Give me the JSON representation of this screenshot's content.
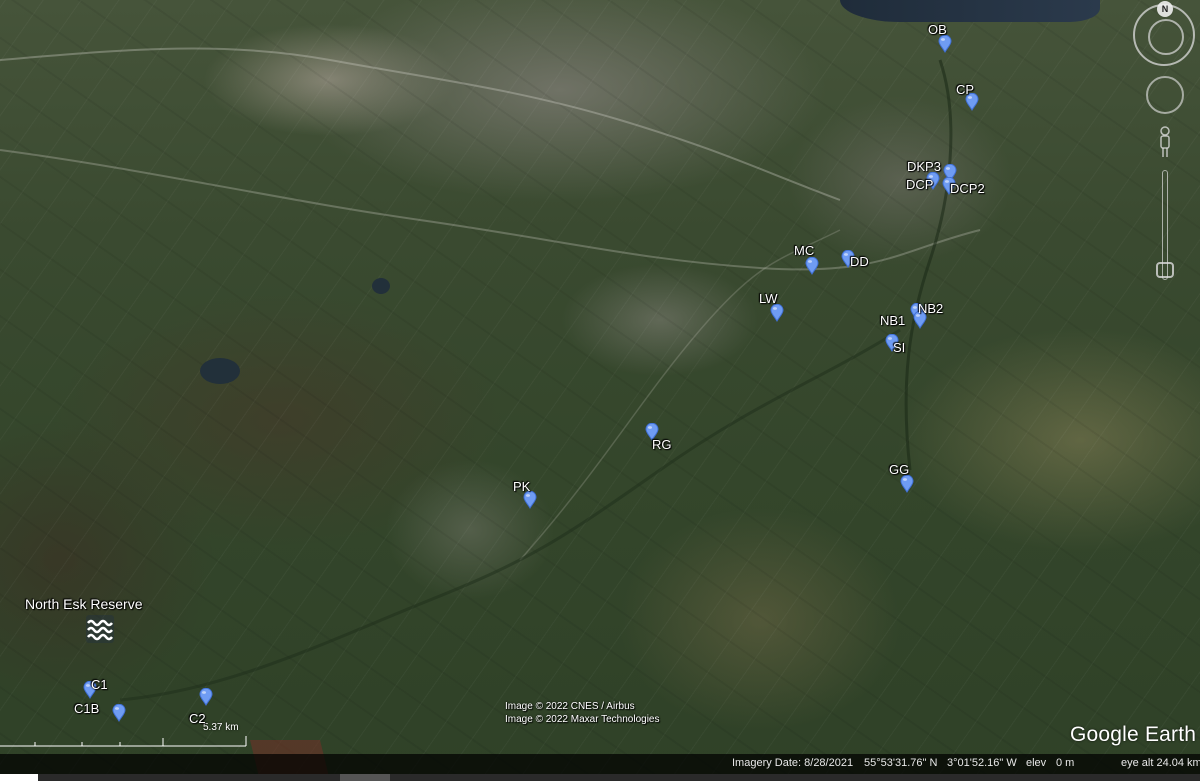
{
  "app": {
    "brand": "Google Earth",
    "north_glyph": "N"
  },
  "placemarks": [
    {
      "id": "OB",
      "label": "OB"
    },
    {
      "id": "CP",
      "label": "CP"
    },
    {
      "id": "DKP3",
      "label": "DKP3"
    },
    {
      "id": "DCP",
      "label": "DCP"
    },
    {
      "id": "DCP2",
      "label": "DCP2"
    },
    {
      "id": "MC",
      "label": "MC"
    },
    {
      "id": "DD",
      "label": "DD"
    },
    {
      "id": "LW",
      "label": "LW"
    },
    {
      "id": "NB2",
      "label": "NB2"
    },
    {
      "id": "NB1",
      "label": "NB1"
    },
    {
      "id": "SI",
      "label": "SI"
    },
    {
      "id": "RG",
      "label": "RG"
    },
    {
      "id": "GG",
      "label": "GG"
    },
    {
      "id": "PK",
      "label": "PK"
    },
    {
      "id": "C1",
      "label": "C1"
    },
    {
      "id": "C1B",
      "label": "C1B"
    },
    {
      "id": "C2",
      "label": "C2"
    }
  ],
  "reserve": {
    "label": "North Esk Reserve",
    "icon": "water-waves-icon"
  },
  "credits": {
    "line1": "Image © 2022 CNES / Airbus",
    "line2": "Image © 2022 Maxar Technologies"
  },
  "scale": {
    "text": "5.37 km"
  },
  "status": {
    "imagery_date": "Imagery Date: 8/28/2021",
    "latitude": "55°53'31.76\" N",
    "longitude": "3°01'52.16\" W",
    "elev_label": "elev",
    "elev_value": "0 m",
    "eye_alt": "eye alt  24.04 km"
  },
  "loading": {
    "fraction": 0.032
  },
  "colors": {
    "pin": "#6f9cf3",
    "pin_dark": "#3f6fd6",
    "label": "#ffffff"
  }
}
